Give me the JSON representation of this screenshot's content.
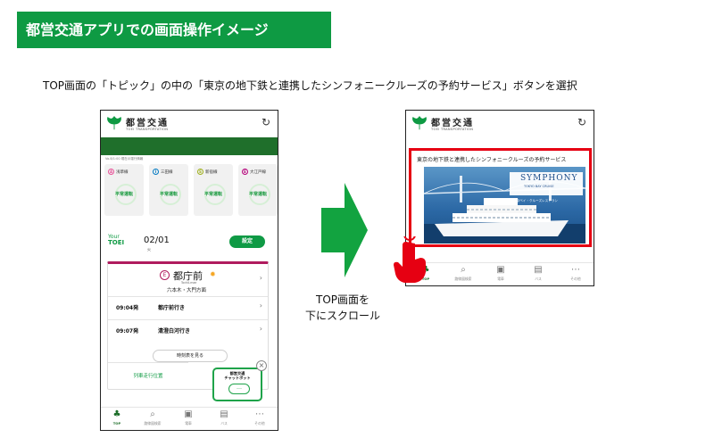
{
  "title": "都営交通アプリでの画面操作イメージ",
  "instruction": "TOP画面の「トピック」の中の「東京の地下鉄と連携したシンフォニークルーズの予約サービス」ボタンを選択",
  "arrow_label": [
    "TOP画面を",
    "下にスクロール"
  ],
  "colors": {
    "brand_green": "#0e9a43",
    "header_bar": "#1f6f2b",
    "highlight_red": "#e60012",
    "route_accent": "#b01b5e"
  },
  "app": {
    "brand": "都営交通",
    "brand_sub": "TOEI TRANSPORTATION",
    "reload_icon": "reload-icon"
  },
  "left_screen": {
    "lines_caption": "Vo.8/1:00 現在の運行情報",
    "lines": [
      {
        "code": "A",
        "name": "浅草線",
        "status": "平常運転",
        "color": "#e85298"
      },
      {
        "code": "I",
        "name": "三田線",
        "status": "平常運転",
        "color": "#0079c2"
      },
      {
        "code": "S",
        "name": "新宿線",
        "status": "平常運転",
        "color": "#9fb01c"
      },
      {
        "code": "E",
        "name": "大江戸線",
        "status": "平常運転",
        "color": "#b6007a"
      }
    ],
    "your_toei": {
      "your": "Your",
      "toei": "TOEI"
    },
    "date": "02/01",
    "weekday": "火",
    "setting_button": "設定",
    "station": {
      "icon": "E",
      "name": "都庁前",
      "roman": "Tochō-mae",
      "direction": "六本木・大門方面"
    },
    "departures": [
      {
        "time": "09:04発",
        "dest": "都庁前行き"
      },
      {
        "time": "09:07発",
        "dest": "清澄白河行き"
      }
    ],
    "timetable_button": "時刻表を見る",
    "train_location": "列車走行位置",
    "chatbot": {
      "title": "都営交通\nチャットボット",
      "bubble": "…"
    },
    "chatbot_close": "×"
  },
  "right_screen": {
    "topic_caption": "東京の地下鉄と連携したシンフォニークルーズの予約サービス",
    "banner": {
      "symphony": "SYMPHONY",
      "symphony_en": "TOKYO BAY CRUISE",
      "symphony_jp": "東京ベイ・クルーズレストラン"
    }
  },
  "tabs_left": [
    {
      "label": "TOP",
      "icon": "ginkgo-icon",
      "active": true
    },
    {
      "label": "路線図検索",
      "icon": "search-icon",
      "active": false
    },
    {
      "label": "電車",
      "icon": "train-icon",
      "active": false
    },
    {
      "label": "バス",
      "icon": "bus-icon",
      "active": false
    },
    {
      "label": "その他",
      "icon": "more-icon",
      "active": false
    }
  ],
  "tabs_right": [
    {
      "label": "TOP",
      "icon": "ginkgo-icon",
      "active": true
    },
    {
      "label": "路線図検索",
      "icon": "search-icon",
      "active": false
    },
    {
      "label": "電車",
      "icon": "train-icon",
      "active": false
    },
    {
      "label": "バス",
      "icon": "bus-icon",
      "active": false
    },
    {
      "label": "その他",
      "icon": "more-icon",
      "active": false
    }
  ]
}
